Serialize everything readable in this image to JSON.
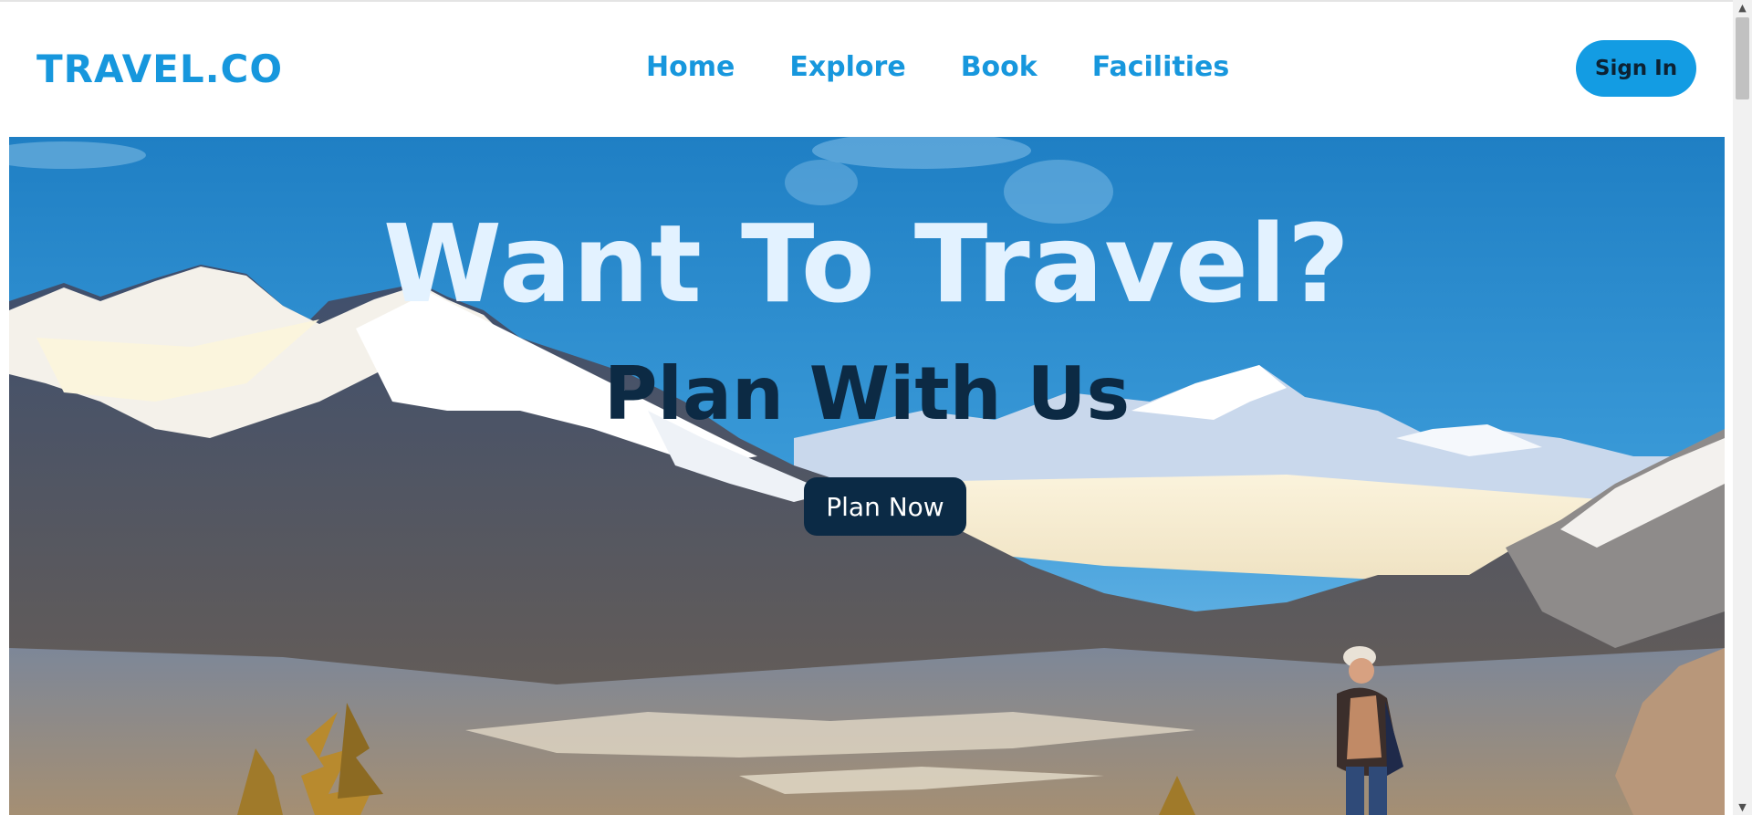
{
  "header": {
    "logo": "TRAVEL.CO",
    "nav": [
      "Home",
      "Explore",
      "Book",
      "Facilities"
    ],
    "signin_label": "Sign In"
  },
  "hero": {
    "headline": "Want To Travel?",
    "subline": "Plan With Us",
    "button_label": "Plan Now",
    "image_description_icon": "mountain-landscape-image"
  },
  "colors": {
    "brand": "#1797dd",
    "signin_bg": "#139ce3",
    "button_dark": "#0b2a45",
    "headline": "#e3f2ff"
  },
  "scrollbar": {
    "up_icon": "arrow-up-icon",
    "down_icon": "arrow-down-icon"
  }
}
